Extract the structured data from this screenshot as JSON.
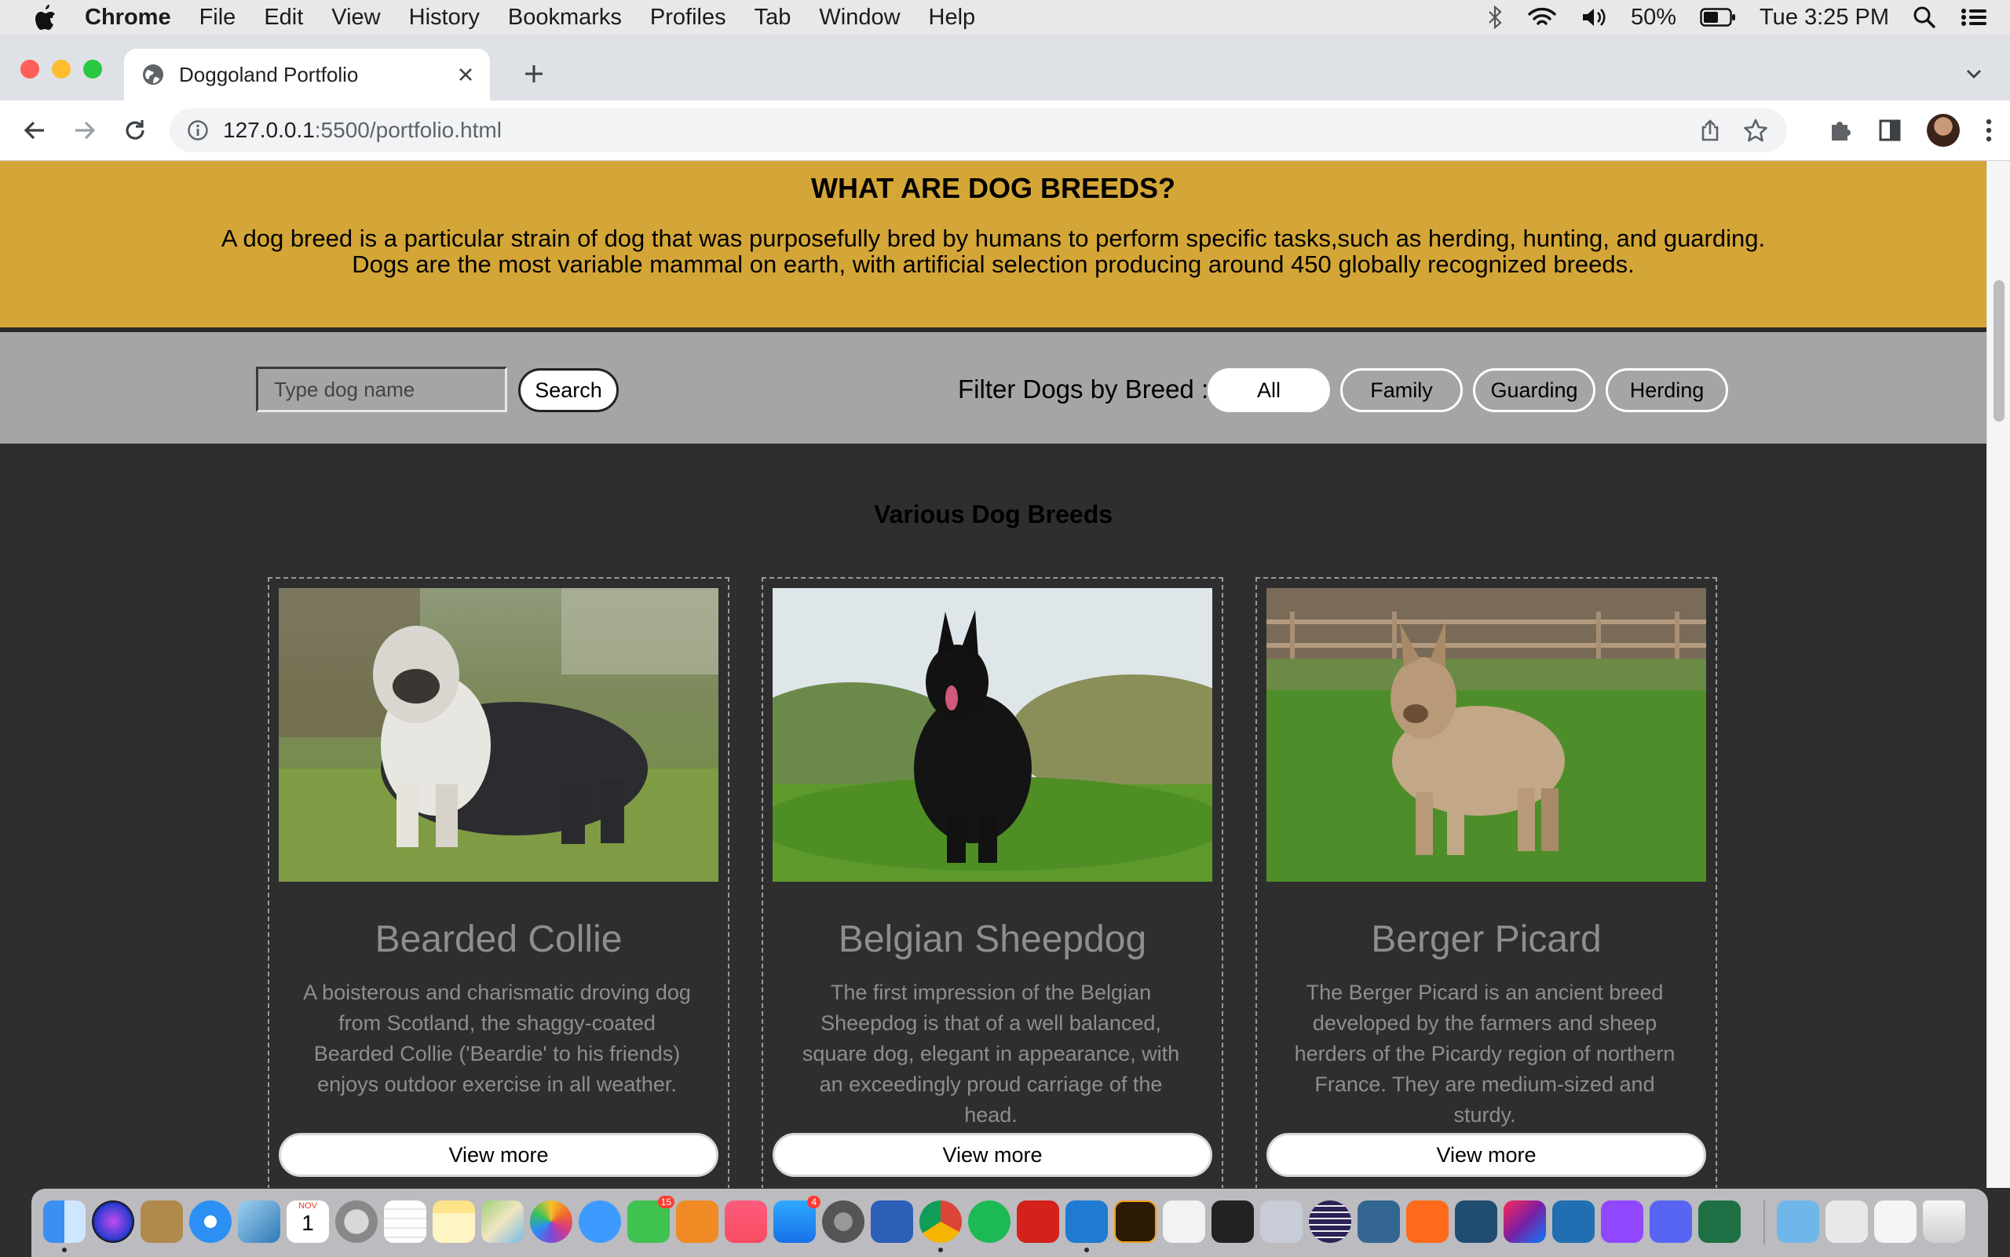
{
  "menubar": {
    "items": [
      "Chrome",
      "File",
      "Edit",
      "View",
      "History",
      "Bookmarks",
      "Profiles",
      "Tab",
      "Window",
      "Help"
    ],
    "battery": "50%",
    "clock": "Tue 3:25 PM"
  },
  "browser": {
    "tab_title": "Doggoland Portfolio",
    "url_host": "127.0.0.1",
    "url_path": ":5500/portfolio.html"
  },
  "hero": {
    "title": "WHAT ARE DOG BREEDS?",
    "line1": "A dog breed is a particular strain of dog that was purposefully bred by humans to perform specific tasks,such as herding, hunting, and guarding.",
    "line2": "Dogs are the most variable mammal on earth, with artificial selection producing around 450 globally recognized breeds."
  },
  "filters": {
    "search_placeholder": "Type dog name",
    "search_label": "Search",
    "filter_label": "Filter Dogs by Breed :",
    "options": [
      "All",
      "Family",
      "Guarding",
      "Herding"
    ],
    "active": "All"
  },
  "section_title": "Various Dog Breeds",
  "cards": [
    {
      "name": "Bearded Collie",
      "description": "A boisterous and charismatic droving dog from Scotland, the shaggy-coated Bearded Collie ('Beardie'   to his friends) enjoys outdoor exercise in all weather.",
      "button": "View more"
    },
    {
      "name": "Belgian Sheepdog",
      "description": "The first impression of the Belgian Sheepdog is that of a well balanced, square dog, elegant in appearance, with an exceedingly proud carriage of the head.",
      "button": "View more"
    },
    {
      "name": "Berger Picard",
      "description": "The Berger Picard is an ancient breed developed by the farmers and sheep herders of the Picardy region of northern France. They are medium-sized and sturdy.",
      "button": "View more"
    }
  ],
  "dock_apps": [
    "finder",
    "siri",
    "notes-brown",
    "safari",
    "preview",
    "calendar",
    "launchpad",
    "reminders",
    "stickies",
    "maps",
    "photos",
    "messages",
    "facetime",
    "books",
    "music",
    "app-store",
    "system-preferences",
    "word",
    "chrome",
    "spotify",
    "acrobat",
    "vscode",
    "illustrator",
    "textedit",
    "terminal",
    "utility",
    "eclipse",
    "postgres",
    "sublime",
    "mysql-workbench",
    "intellij",
    "tableplus",
    "twitch",
    "discord",
    "excel",
    "folder",
    "downloads",
    "screenshot",
    "trash"
  ],
  "calendar_month": "NOV",
  "calendar_day": "1",
  "badges": {
    "facetime": "15",
    "app_store": "4"
  }
}
